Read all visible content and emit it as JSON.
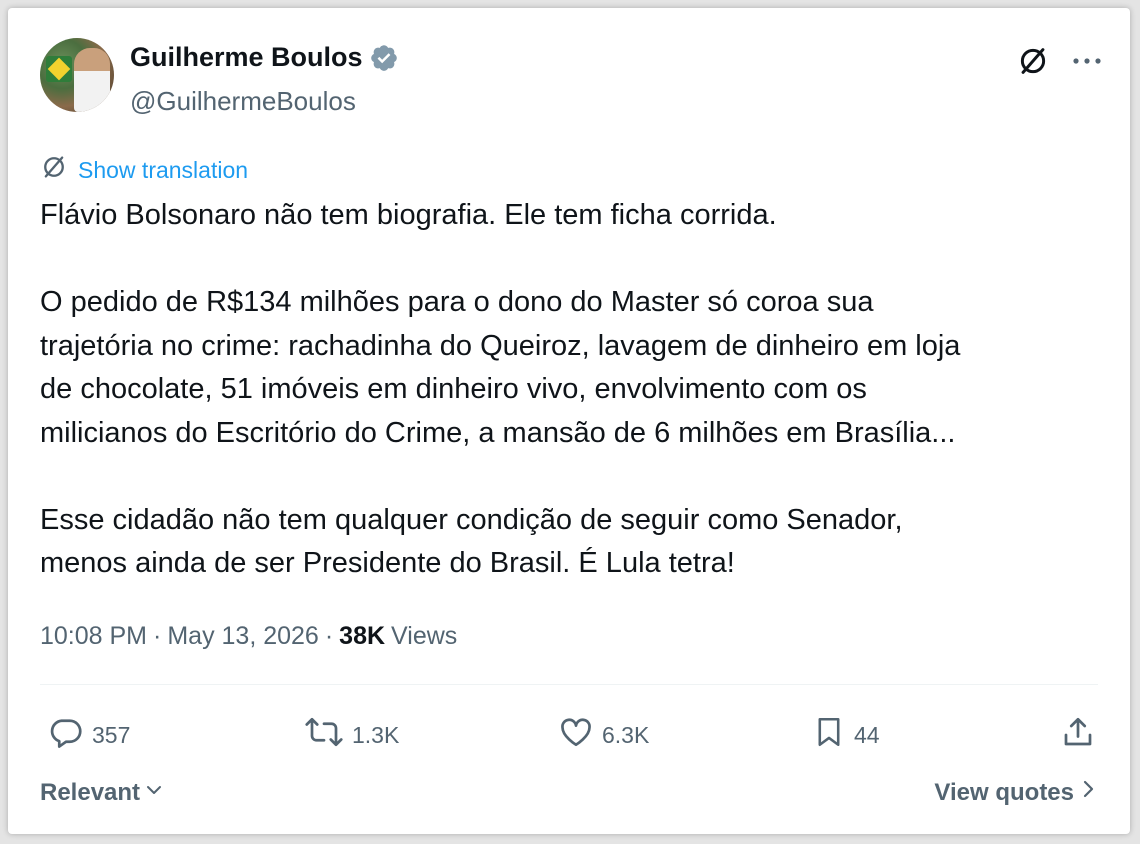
{
  "author": {
    "name": "Guilherme Boulos",
    "handle": "@GuilhermeBoulos"
  },
  "translation_label": "Show translation",
  "tweet": {
    "paragraphs": [
      [
        "Flávio Bolsonaro não tem biografia. Ele tem ficha corrida."
      ],
      [
        "O pedido de R$134 milhões para o dono do Master só coroa sua",
        "trajetória no crime: rachadinha do Queiroz, lavagem de dinheiro em loja",
        "de chocolate, 51 imóveis em dinheiro vivo, envolvimento com os",
        "milicianos do Escritório do Crime, a mansão de 6 milhões em Brasília..."
      ],
      [
        "Esse cidadão não tem qualquer condição de seguir como Senador,",
        "menos ainda de ser Presidente do Brasil. É Lula tetra!"
      ]
    ]
  },
  "meta": {
    "time": "10:08 PM",
    "separator": "·",
    "date": "May 13, 2026",
    "views_count": "38K",
    "views_label": "Views"
  },
  "actions": {
    "replies": "357",
    "reposts": "1.3K",
    "likes": "6.3K",
    "bookmarks": "44"
  },
  "footer": {
    "sort_label": "Relevant",
    "quotes_label": "View quotes"
  },
  "icons": [
    "verified-badge-icon",
    "translate-icon",
    "more-icon",
    "reply-icon",
    "repost-icon",
    "like-icon",
    "bookmark-icon",
    "share-icon",
    "chevron-down-icon",
    "chevron-right-icon"
  ],
  "colors": {
    "accent": "#1d9bf0",
    "text": "#0f1419",
    "secondary": "#536471",
    "verified": "#829aab"
  }
}
